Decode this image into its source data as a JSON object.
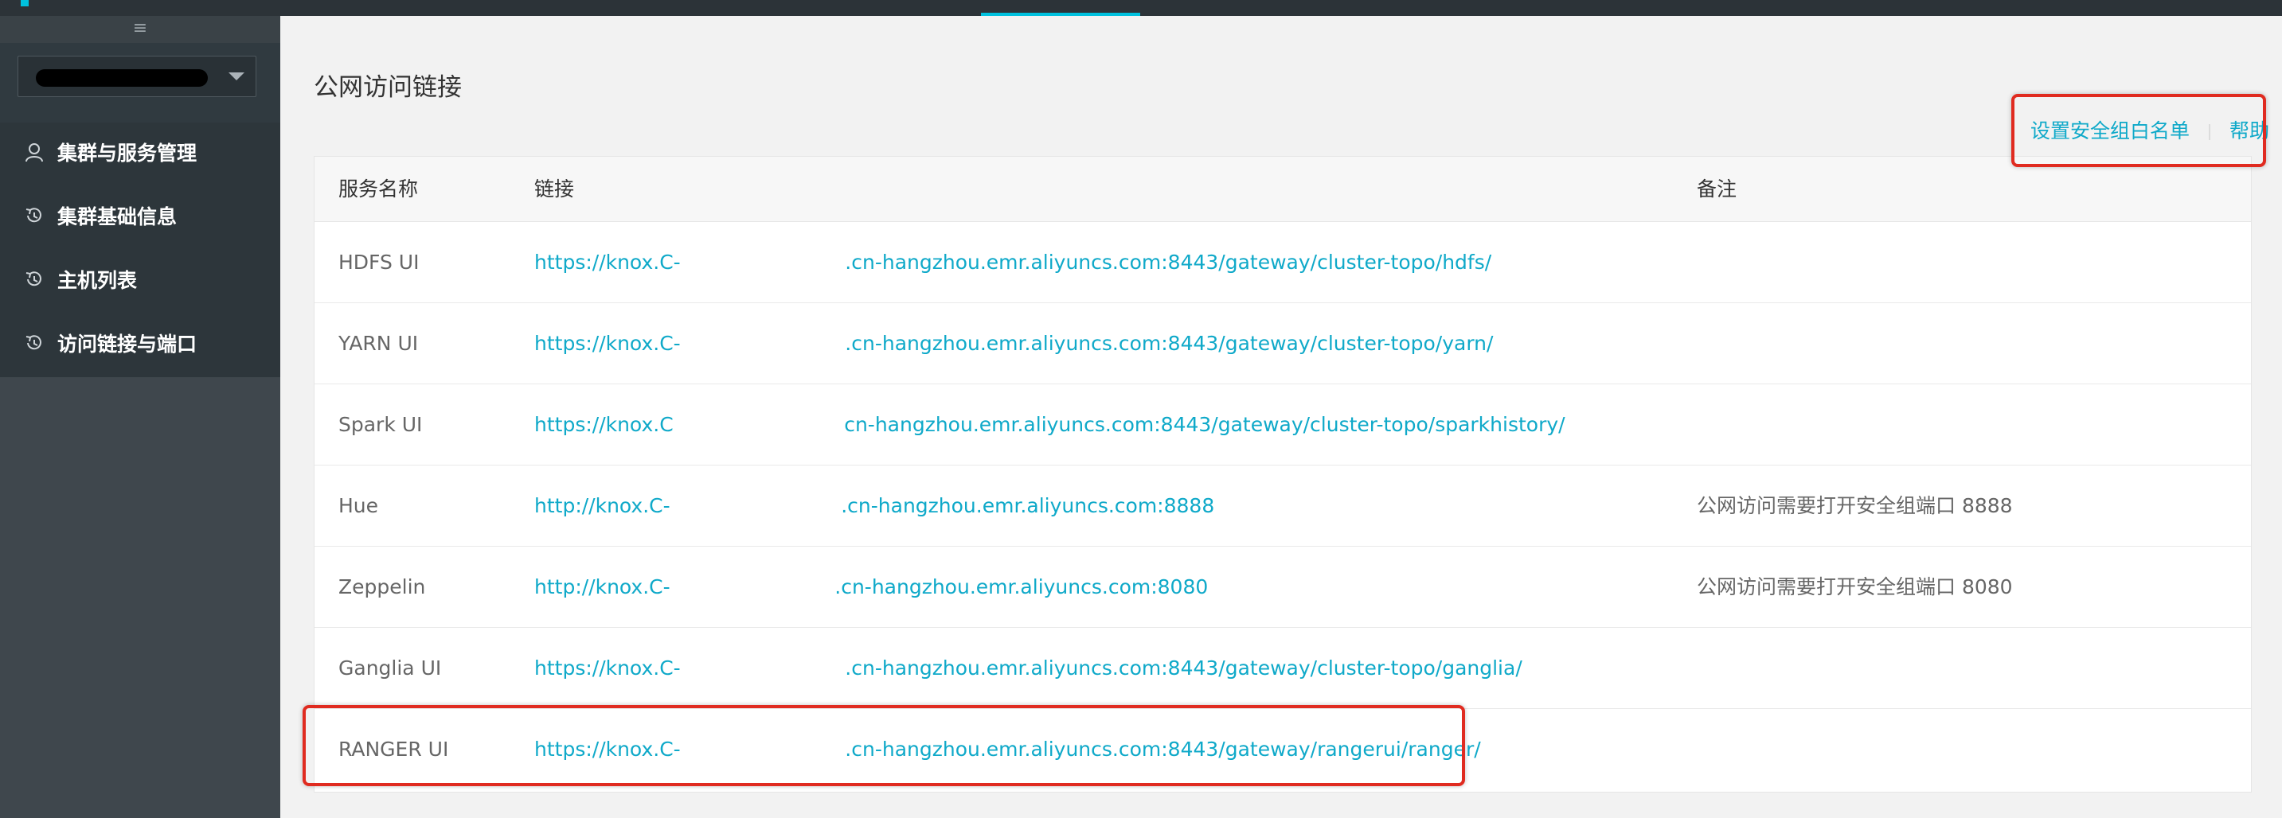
{
  "sidebar": {
    "toggle_icon": "≡",
    "items": [
      {
        "label": "集群与服务管理",
        "icon": "user-icon"
      },
      {
        "label": "集群基础信息",
        "icon": "history-icon"
      },
      {
        "label": "主机列表",
        "icon": "history-icon"
      },
      {
        "label": "访问链接与端口",
        "icon": "history-icon"
      }
    ]
  },
  "main": {
    "title": "公网访问链接",
    "actions": {
      "whitelist_label": "设置安全组白名单",
      "help_label": "帮助"
    }
  },
  "table": {
    "headers": [
      "服务名称",
      "链接",
      "备注"
    ],
    "rows": [
      {
        "name": "HDFS UI",
        "link": "https://knox.C-                          .cn-hangzhou.emr.aliyuncs.com:8443/gateway/cluster-topo/hdfs/",
        "note": ""
      },
      {
        "name": "YARN UI",
        "link": "https://knox.C-                          .cn-hangzhou.emr.aliyuncs.com:8443/gateway/cluster-topo/yarn/",
        "note": ""
      },
      {
        "name": "Spark UI",
        "link": "https://knox.C                           cn-hangzhou.emr.aliyuncs.com:8443/gateway/cluster-topo/sparkhistory/",
        "note": ""
      },
      {
        "name": "Hue",
        "link": "http://knox.C-                           .cn-hangzhou.emr.aliyuncs.com:8888",
        "note": "公网访问需要打开安全组端口 8888"
      },
      {
        "name": "Zeppelin",
        "link": "http://knox.C-                          .cn-hangzhou.emr.aliyuncs.com:8080",
        "note": "公网访问需要打开安全组端口 8080"
      },
      {
        "name": "Ganglia UI",
        "link": "https://knox.C-                          .cn-hangzhou.emr.aliyuncs.com:8443/gateway/cluster-topo/ganglia/",
        "note": ""
      },
      {
        "name": "RANGER UI",
        "link": "https://knox.C-                          .cn-hangzhou.emr.aliyuncs.com:8443/gateway/rangerui/ranger/",
        "note": ""
      }
    ]
  },
  "colors": {
    "accent": "#0fa9c9",
    "sidebar_bg": "#3f474d",
    "highlight_border": "#e02b20"
  }
}
